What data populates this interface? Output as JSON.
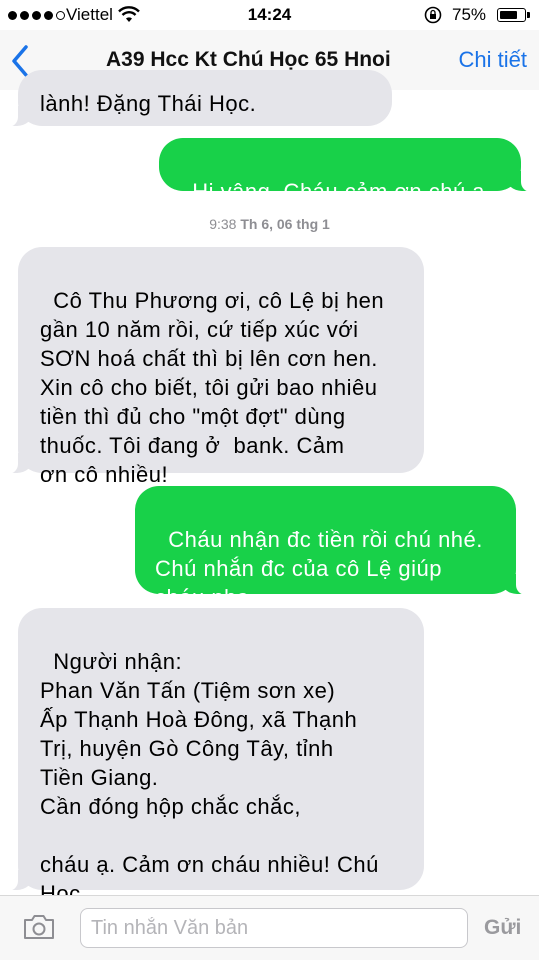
{
  "status_bar": {
    "carrier": "Viettel",
    "time": "14:24",
    "battery_percent": "75%",
    "battery_level": 0.75,
    "signal_bars": 4,
    "signal_max": 5
  },
  "nav": {
    "title": "A39 Hcc Kt Chú Học 65 Hnoi",
    "details": "Chi tiết",
    "back_icon": "chevron-left-icon"
  },
  "messages": [
    {
      "direction": "incoming",
      "text": "lành! Đặng Thái Học."
    },
    {
      "direction": "outgoing",
      "text": "Hi vâng. Cháu cảm ơn chú ạ."
    },
    {
      "direction": "incoming",
      "text": "Cô Thu Phương ơi, cô Lệ bị hen\ngần 10 năm rồi, cứ tiếp xúc với\nSƠN hoá chất thì bị lên cơn hen.\nXin cô cho biết, tôi gửi bao nhiêu\ntiền thì đủ cho \"một đợt\" dùng\nthuốc. Tôi đang ở  bank. Cảm\nơn cô nhiều!"
    },
    {
      "direction": "outgoing",
      "text": "Cháu nhận đc tiền rồi chú nhé.\nChú nhắn đc của cô Lệ giúp\ncháu nha"
    },
    {
      "direction": "incoming",
      "text": "Người nhận:\nPhan Văn Tấn (Tiệm sơn xe)\nẤp Thạnh Hoà Đông, xã Thạnh\nTrị, huyện Gò Công Tây, tỉnh\nTiền Giang.\nCần đóng hộp chắc chắc,\n\ncháu ạ. Cảm ơn cháu nhiều! Chú\nHọc."
    }
  ],
  "timestamp": {
    "time": "9:38",
    "day": "Th 6,",
    "date": "06 thg 1"
  },
  "input_bar": {
    "placeholder": "Tin nhắn Văn bản",
    "value": "",
    "send_label": "Gửi",
    "camera_icon": "camera-icon"
  },
  "colors": {
    "outgoing_bubble": "#18d149",
    "incoming_bubble": "#e5e5ea",
    "accent": "#1a73e8"
  }
}
